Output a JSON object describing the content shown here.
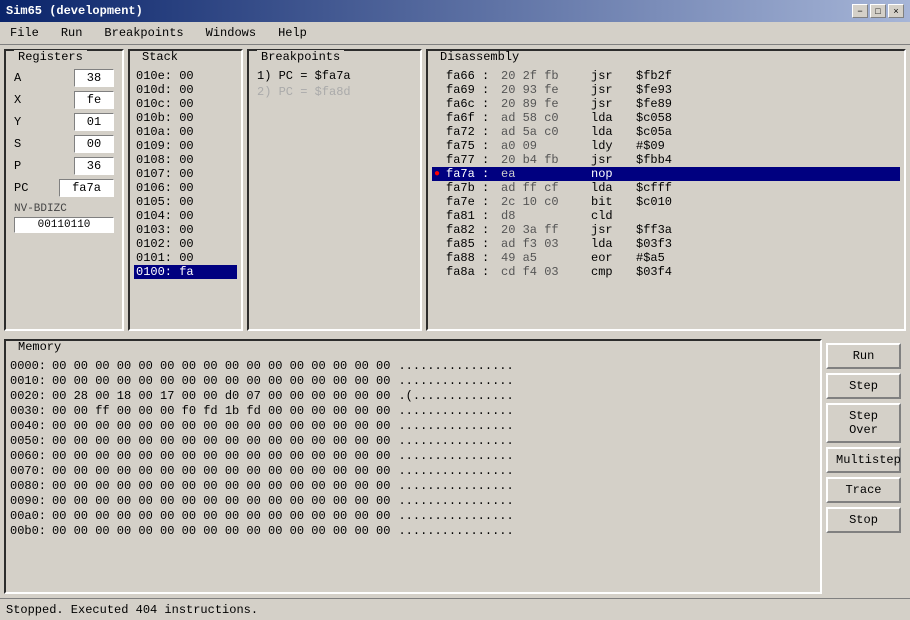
{
  "titleBar": {
    "title": "Sim65 (development)",
    "buttons": [
      "−",
      "□",
      "×"
    ]
  },
  "menu": {
    "items": [
      "File",
      "Run",
      "Breakpoints",
      "Windows",
      "Help"
    ]
  },
  "registers": {
    "label": "Registers",
    "items": [
      {
        "name": "A",
        "value": "38"
      },
      {
        "name": "X",
        "value": "fe"
      },
      {
        "name": "Y",
        "value": "01"
      },
      {
        "name": "S",
        "value": "00"
      },
      {
        "name": "P",
        "value": "36"
      },
      {
        "name": "PC",
        "value": "fa7a"
      },
      {
        "name": "NV-BDIZC",
        "value": ""
      },
      {
        "name": "flags",
        "value": "00110110"
      }
    ]
  },
  "stack": {
    "label": "Stack",
    "rows": [
      {
        "addr": "010e:",
        "val": "00",
        "highlight": false
      },
      {
        "addr": "010d:",
        "val": "00",
        "highlight": false
      },
      {
        "addr": "010c:",
        "val": "00",
        "highlight": false
      },
      {
        "addr": "010b:",
        "val": "00",
        "highlight": false
      },
      {
        "addr": "010a:",
        "val": "00",
        "highlight": false
      },
      {
        "addr": "0109:",
        "val": "00",
        "highlight": false
      },
      {
        "addr": "0108:",
        "val": "00",
        "highlight": false
      },
      {
        "addr": "0107:",
        "val": "00",
        "highlight": false
      },
      {
        "addr": "0106:",
        "val": "00",
        "highlight": false
      },
      {
        "addr": "0105:",
        "val": "00",
        "highlight": false
      },
      {
        "addr": "0104:",
        "val": "00",
        "highlight": false
      },
      {
        "addr": "0103:",
        "val": "00",
        "highlight": false
      },
      {
        "addr": "0102:",
        "val": "00",
        "highlight": false
      },
      {
        "addr": "0101:",
        "val": "00",
        "highlight": false
      },
      {
        "addr": "0100:",
        "val": "fa",
        "highlight": true
      }
    ]
  },
  "breakpoints": {
    "label": "Breakpoints",
    "items": [
      {
        "text": "1) PC = $fa7a",
        "active": true
      },
      {
        "text": "2) PC = $fa8d",
        "active": false
      }
    ]
  },
  "disassembly": {
    "label": "Disassembly",
    "rows": [
      {
        "addr": "fa66",
        "sep": ":",
        "bytes": "20 2f fb",
        "mnemonic": "jsr",
        "operand": "$fb2f",
        "current": false
      },
      {
        "addr": "fa69",
        "sep": ":",
        "bytes": "20 93 fe",
        "mnemonic": "jsr",
        "operand": "$fe93",
        "current": false
      },
      {
        "addr": "fa6c",
        "sep": ":",
        "bytes": "20 89 fe",
        "mnemonic": "jsr",
        "operand": "$fe89",
        "current": false
      },
      {
        "addr": "fa6f",
        "sep": ":",
        "bytes": "ad 58 c0",
        "mnemonic": "lda",
        "operand": "$c058",
        "current": false
      },
      {
        "addr": "fa72",
        "sep": ":",
        "bytes": "ad 5a c0",
        "mnemonic": "lda",
        "operand": "$c05a",
        "current": false
      },
      {
        "addr": "fa75",
        "sep": ":",
        "bytes": "a0 09",
        "mnemonic": "ldy",
        "operand": "#$09",
        "current": false
      },
      {
        "addr": "fa77",
        "sep": ":",
        "bytes": "20 b4 fb",
        "mnemonic": "jsr",
        "operand": "$fbb4",
        "current": false
      },
      {
        "addr": "fa7a",
        "sep": ":",
        "bytes": "ea",
        "mnemonic": "nop",
        "operand": "",
        "current": true
      },
      {
        "addr": "fa7b",
        "sep": ":",
        "bytes": "ad ff cf",
        "mnemonic": "lda",
        "operand": "$cfff",
        "current": false
      },
      {
        "addr": "fa7e",
        "sep": ":",
        "bytes": "2c 10 c0",
        "mnemonic": "bit",
        "operand": "$c010",
        "current": false
      },
      {
        "addr": "fa81",
        "sep": ":",
        "bytes": "d8",
        "mnemonic": "cld",
        "operand": "",
        "current": false
      },
      {
        "addr": "fa82",
        "sep": ":",
        "bytes": "20 3a ff",
        "mnemonic": "jsr",
        "operand": "$ff3a",
        "current": false
      },
      {
        "addr": "fa85",
        "sep": ":",
        "bytes": "ad f3 03",
        "mnemonic": "lda",
        "operand": "$03f3",
        "current": false
      },
      {
        "addr": "fa88",
        "sep": ":",
        "bytes": "49 a5",
        "mnemonic": "eor",
        "operand": "#$a5",
        "current": false
      },
      {
        "addr": "fa8a",
        "sep": ":",
        "bytes": "cd f4 03",
        "mnemonic": "cmp",
        "operand": "$03f4",
        "current": false
      }
    ]
  },
  "memory": {
    "label": "Memory",
    "rows": [
      {
        "addr": "0000:",
        "bytes": "00 00 00 00 00 00 00 00   00 00 00 00 00 00 00 00",
        "ascii": "................"
      },
      {
        "addr": "0010:",
        "bytes": "00 00 00 00 00 00 00 00   00 00 00 00 00 00 00 00",
        "ascii": "................"
      },
      {
        "addr": "0020:",
        "bytes": "00 28 00 18 00 17 00 00   d0 07 00 00 00 00 00 00",
        "ascii": ".(.............."
      },
      {
        "addr": "0030:",
        "bytes": "00 00 ff 00 00 00 f0 fd   1b fd 00 00 00 00 00 00",
        "ascii": "................"
      },
      {
        "addr": "0040:",
        "bytes": "00 00 00 00 00 00 00 00   00 00 00 00 00 00 00 00",
        "ascii": "................"
      },
      {
        "addr": "0050:",
        "bytes": "00 00 00 00 00 00 00 00   00 00 00 00 00 00 00 00",
        "ascii": "................"
      },
      {
        "addr": "0060:",
        "bytes": "00 00 00 00 00 00 00 00   00 00 00 00 00 00 00 00",
        "ascii": "................"
      },
      {
        "addr": "0070:",
        "bytes": "00 00 00 00 00 00 00 00   00 00 00 00 00 00 00 00",
        "ascii": "................"
      },
      {
        "addr": "0080:",
        "bytes": "00 00 00 00 00 00 00 00   00 00 00 00 00 00 00 00",
        "ascii": "................"
      },
      {
        "addr": "0090:",
        "bytes": "00 00 00 00 00 00 00 00   00 00 00 00 00 00 00 00",
        "ascii": "................"
      },
      {
        "addr": "00a0:",
        "bytes": "00 00 00 00 00 00 00 00   00 00 00 00 00 00 00 00",
        "ascii": "................"
      },
      {
        "addr": "00b0:",
        "bytes": "00 00 00 00 00 00 00 00   00 00 00 00 00 00 00 00",
        "ascii": "................"
      }
    ]
  },
  "buttons": {
    "run": "Run",
    "step": "Step",
    "stepOver": "Step Over",
    "multistep": "Multistep",
    "trace": "Trace",
    "stop": "Stop"
  },
  "statusBar": {
    "text": "Stopped. Executed 404 instructions."
  }
}
